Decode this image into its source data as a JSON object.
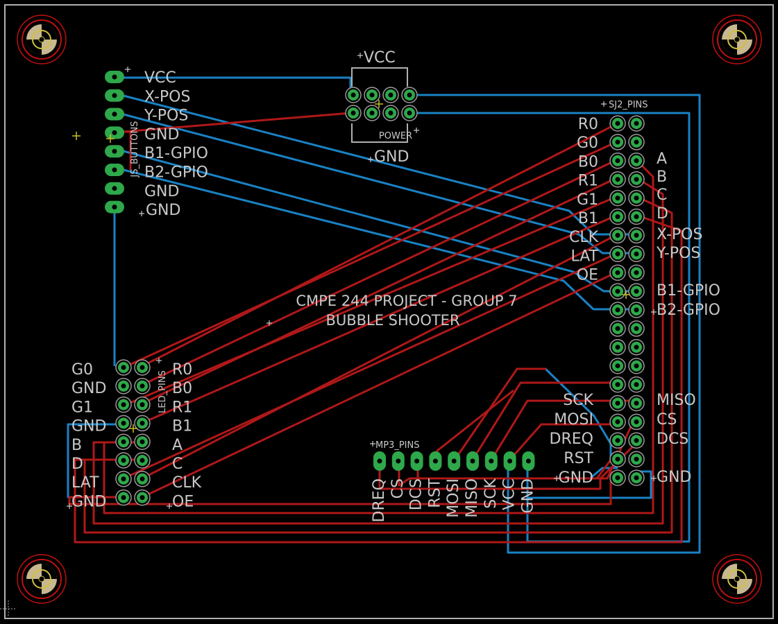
{
  "board": {
    "title_line1": "CMPE 244 PROJECT - GROUP 7",
    "title_line2": "BUBBLE SHOOTER"
  },
  "colors": {
    "background": "#000000",
    "outline": "#b0b0b0",
    "top_trace": "#b01818",
    "bottom_trace": "#1a82c4",
    "pad": "#2ea84a",
    "silk": "#c8c8c8",
    "hole_ring": "#c01010",
    "hole_fill": "#c8b890"
  },
  "power": {
    "name": "POWER",
    "vcc": "VCC",
    "gnd": "GND"
  },
  "js_header": {
    "name": "JS_BUTTONS",
    "labels": [
      "VCC",
      "X-POS",
      "Y-POS",
      "GND",
      "B1-GPIO",
      "B2-GPIO",
      "GND",
      "GND"
    ]
  },
  "sj2": {
    "name": "SJ2_PINS",
    "left_labels": [
      "R0",
      "G0",
      "B0",
      "R1",
      "G1",
      "B1",
      "CLK",
      "LAT",
      "OE"
    ],
    "right_labels": [
      "A",
      "B",
      "C",
      "D",
      "X-POS",
      "Y-POS",
      "B1-GPIO",
      "B2-GPIO"
    ],
    "spi_left": [
      "SCK",
      "MOSI",
      "DREQ",
      "RST",
      "GND"
    ],
    "spi_right": [
      "MISO",
      "CS",
      "DCS",
      "GND"
    ]
  },
  "led": {
    "name": "LED_PINS",
    "left_labels": [
      "G0",
      "GND",
      "G1",
      "GND",
      "B",
      "D",
      "LAT",
      "GND"
    ],
    "right_labels": [
      "R0",
      "B0",
      "R1",
      "B1",
      "A",
      "C",
      "CLK",
      "OE"
    ]
  },
  "mp3": {
    "name": "MP3_PINS",
    "labels": [
      "DREQ",
      "CS",
      "DCS",
      "RST",
      "MOSI",
      "MISO",
      "SCK",
      "VCC",
      "GND"
    ]
  }
}
